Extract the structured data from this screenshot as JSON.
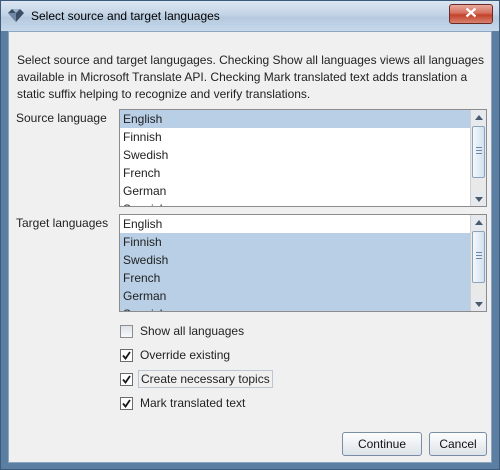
{
  "window": {
    "title": "Select source and target languages",
    "close_icon": "close-icon",
    "app_icon": "diamond-app-icon"
  },
  "description": "Select source and target langugages. Checking Show all languages views all languages available in Microsoft Translate API. Checking Mark translated text adds translation a static suffix helping to recognize and verify translations.",
  "source": {
    "label": "Source language",
    "items": [
      {
        "label": "English",
        "selected": true
      },
      {
        "label": "Finnish",
        "selected": false
      },
      {
        "label": "Swedish",
        "selected": false
      },
      {
        "label": "French",
        "selected": false
      },
      {
        "label": "German",
        "selected": false
      },
      {
        "label": "Spanish",
        "selected": false
      }
    ]
  },
  "target": {
    "label": "Target languages",
    "items": [
      {
        "label": "English",
        "selected": false
      },
      {
        "label": "Finnish",
        "selected": true
      },
      {
        "label": "Swedish",
        "selected": true
      },
      {
        "label": "French",
        "selected": true
      },
      {
        "label": "German",
        "selected": true
      },
      {
        "label": "Spanish",
        "selected": true
      }
    ]
  },
  "options": [
    {
      "label": "Show all languages",
      "checked": false,
      "focused": false
    },
    {
      "label": "Override existing",
      "checked": true,
      "focused": false
    },
    {
      "label": "Create necessary topics",
      "checked": true,
      "focused": true
    },
    {
      "label": "Mark translated text",
      "checked": true,
      "focused": false
    }
  ],
  "buttons": {
    "continue": "Continue",
    "cancel": "Cancel"
  },
  "colors": {
    "selection": "#b8cfe5",
    "title_gradient": "#c3d4e6",
    "close_button": "#c4412b"
  }
}
